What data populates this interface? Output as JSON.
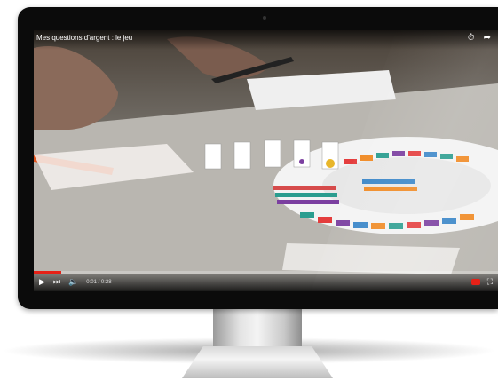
{
  "video": {
    "title": "Mes questions d'argent : le jeu",
    "time": "0:01 / 0:28",
    "progress": 0.06
  },
  "icons": {
    "watch_later": "clock-icon",
    "share": "share-icon",
    "play": "play-icon",
    "next": "next-icon",
    "volume": "volume-icon",
    "youtube": "youtube-logo-icon",
    "fullscreen": "fullscreen-icon"
  },
  "colors": {
    "progress": "#e62117",
    "bezel": "#0b0b0b"
  }
}
